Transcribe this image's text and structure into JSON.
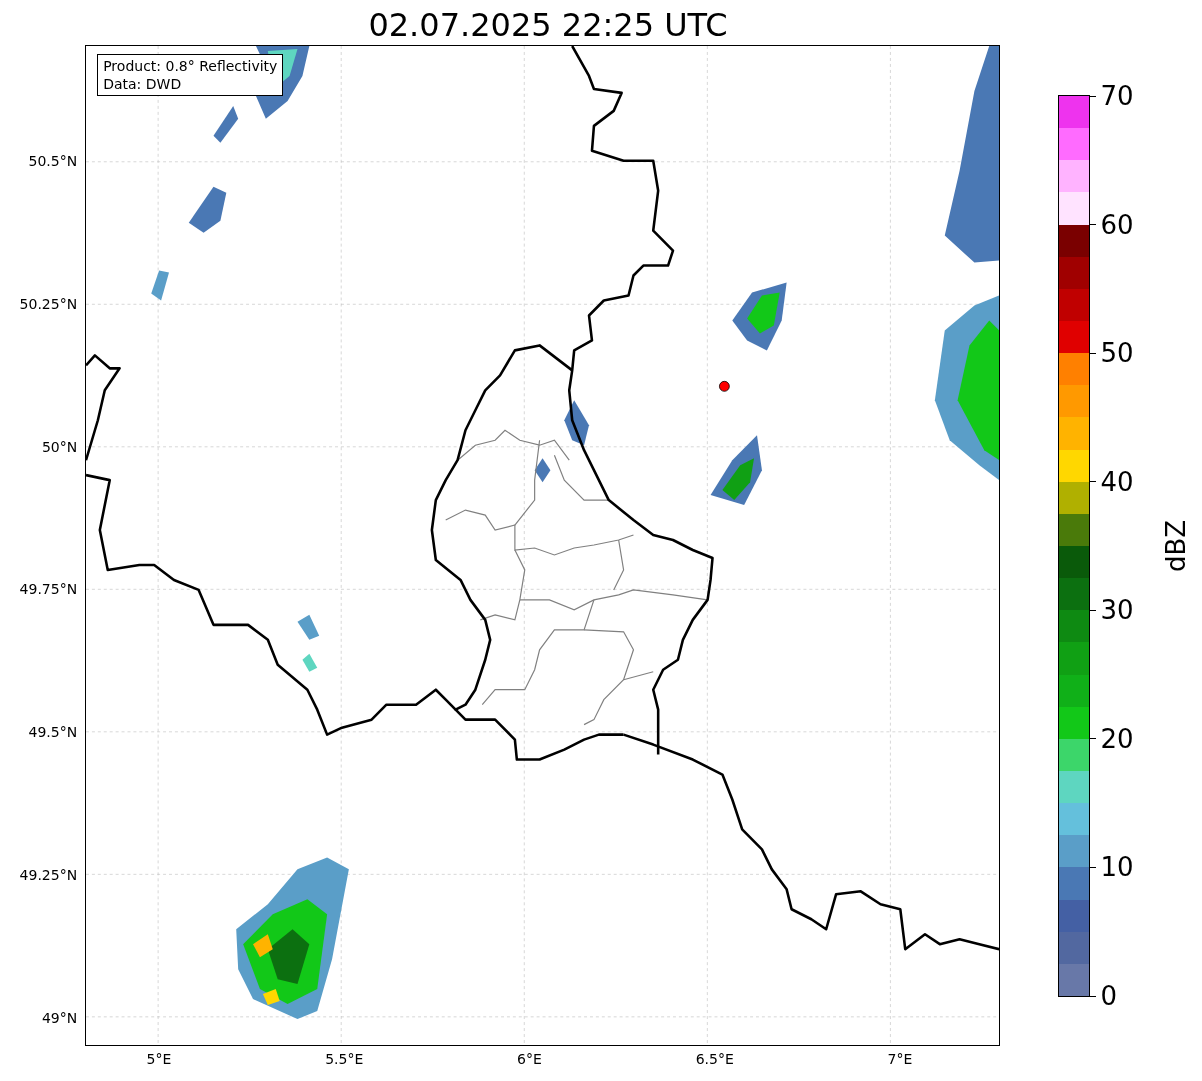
{
  "title": "02.07.2025 22:25 UTC",
  "map": {
    "legend": [
      "Product: 0.8° Reflectivity",
      "Data: DWD"
    ],
    "xticks": [
      "5°E",
      "5.5°E",
      "6°E",
      "6.5°E",
      "7°E"
    ],
    "yticks": [
      "50.5°N",
      "50.25°N",
      "50°N",
      "49.75°N",
      "49.5°N",
      "49.25°N",
      "49°N"
    ]
  },
  "colorbar": {
    "label": "dBZ",
    "ticks": [
      "70",
      "60",
      "50",
      "40",
      "30",
      "20",
      "10",
      "0"
    ],
    "bins": [
      {
        "color": "#6878a8"
      },
      {
        "color": "#5268a0"
      },
      {
        "color": "#4460a4"
      },
      {
        "color": "#4a78b4"
      },
      {
        "color": "#5a9ec8"
      },
      {
        "color": "#64c0dc"
      },
      {
        "color": "#5ed6c0"
      },
      {
        "color": "#3cd66a"
      },
      {
        "color": "#12c818"
      },
      {
        "color": "#10b018"
      },
      {
        "color": "#10a014"
      },
      {
        "color": "#0e8a12"
      },
      {
        "color": "#0c7010"
      },
      {
        "color": "#0a5a0a"
      },
      {
        "color": "#4a7a0a"
      },
      {
        "color": "#b0b000"
      },
      {
        "color": "#ffd700"
      },
      {
        "color": "#ffb300"
      },
      {
        "color": "#ff9900"
      },
      {
        "color": "#ff8000"
      },
      {
        "color": "#e00000"
      },
      {
        "color": "#c00000"
      },
      {
        "color": "#a00000"
      },
      {
        "color": "#7a0000"
      },
      {
        "color": "#ffe3ff"
      },
      {
        "color": "#ffb3ff"
      },
      {
        "color": "#ff6bff"
      },
      {
        "color": "#ee33ee"
      }
    ]
  }
}
